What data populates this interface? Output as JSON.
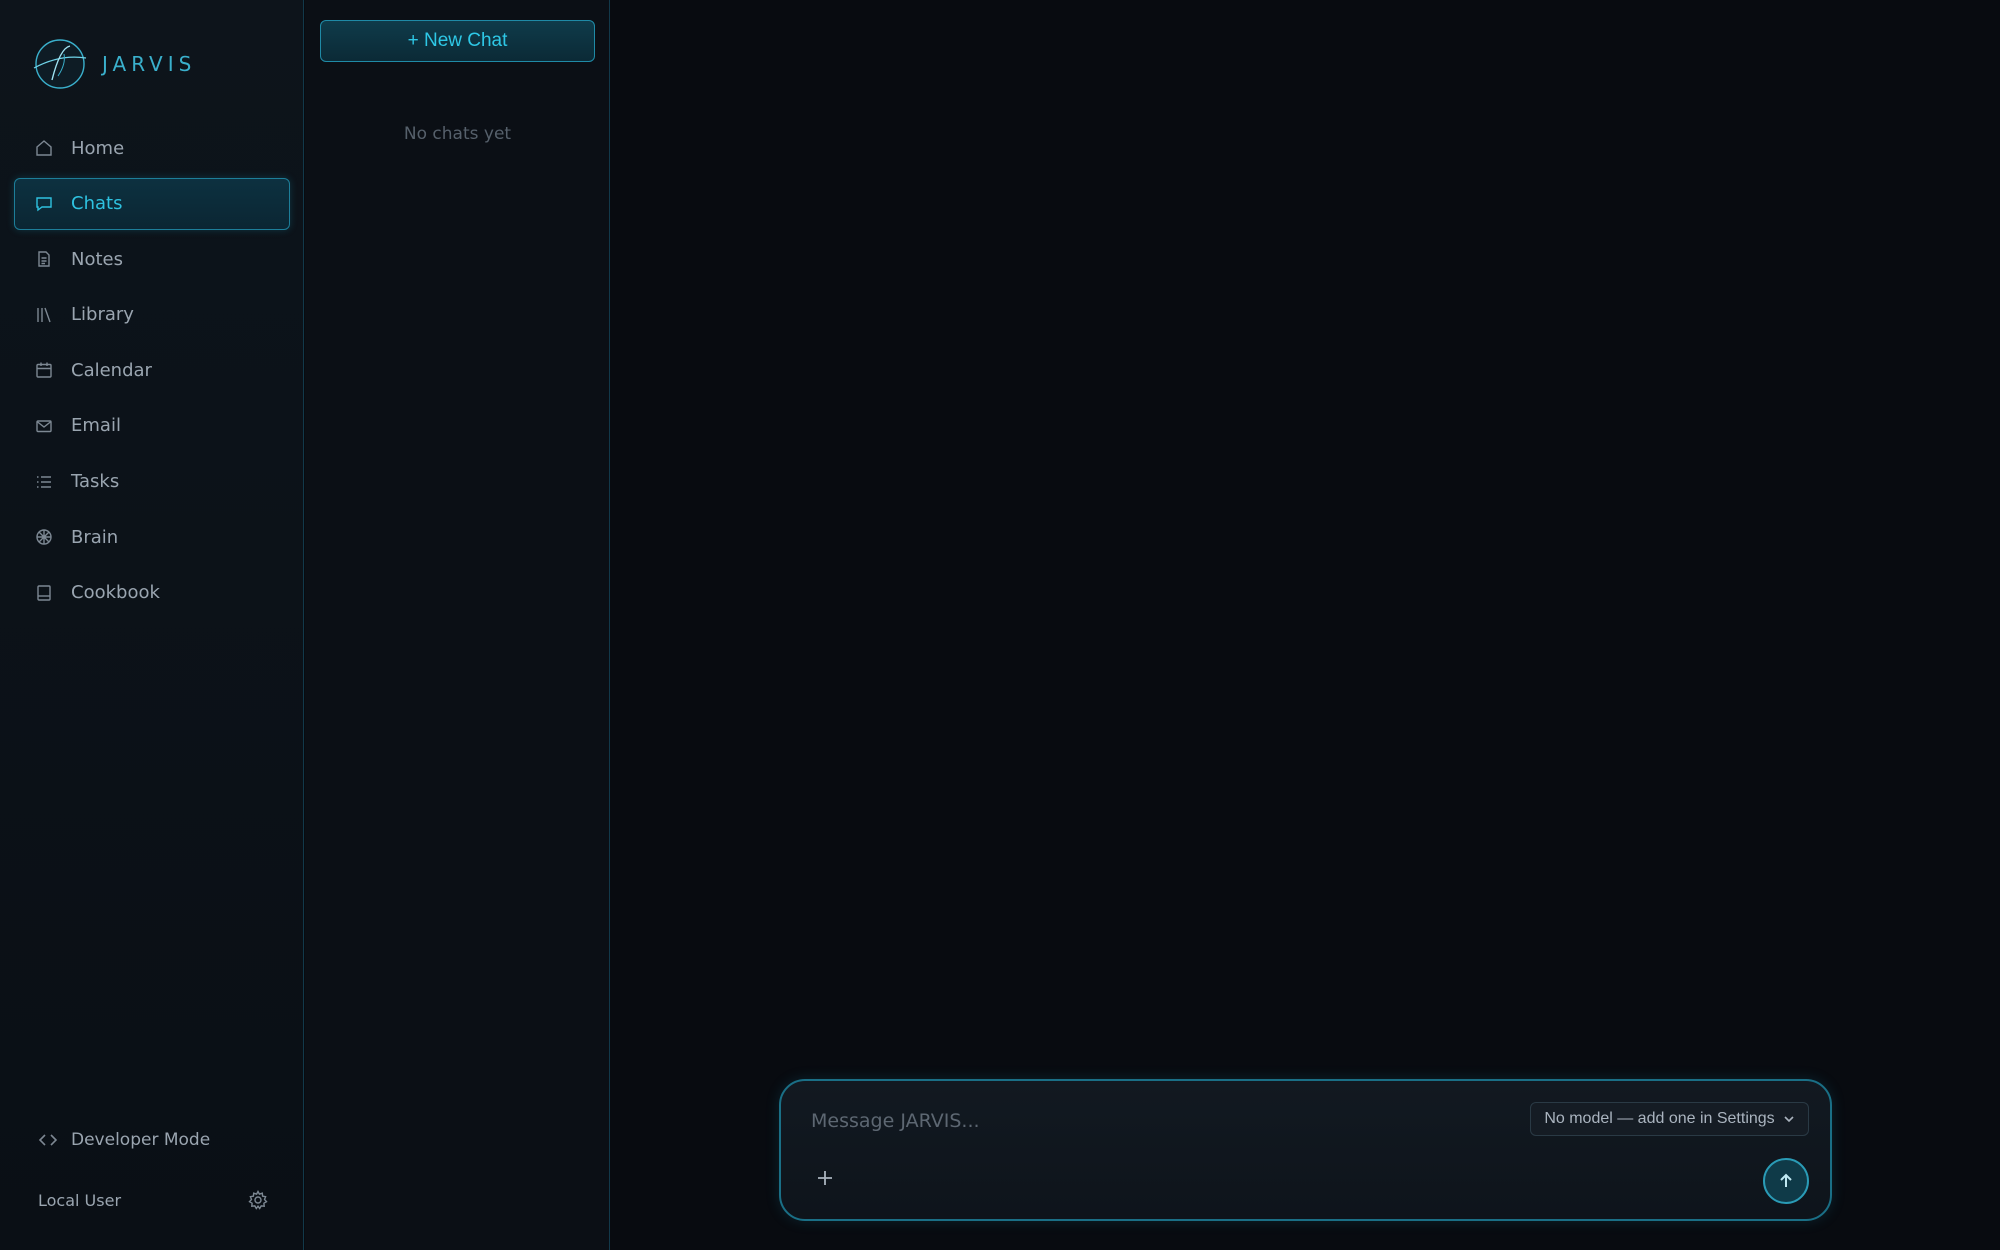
{
  "app": {
    "brand": "JARVIS"
  },
  "sidebar": {
    "items": [
      {
        "label": "Home",
        "icon": "home-icon"
      },
      {
        "label": "Chats",
        "icon": "chat-bubble-icon",
        "active": true
      },
      {
        "label": "Notes",
        "icon": "document-icon"
      },
      {
        "label": "Library",
        "icon": "library-icon"
      },
      {
        "label": "Calendar",
        "icon": "calendar-icon"
      },
      {
        "label": "Email",
        "icon": "envelope-icon"
      },
      {
        "label": "Tasks",
        "icon": "list-icon"
      },
      {
        "label": "Brain",
        "icon": "brain-icon"
      },
      {
        "label": "Cookbook",
        "icon": "book-icon"
      }
    ],
    "developer_mode_label": "Developer Mode",
    "user_label": "Local User"
  },
  "chatlist": {
    "new_chat_label": "+ New Chat",
    "empty_label": "No chats yet"
  },
  "composer": {
    "placeholder": "Message JARVIS...",
    "model_label": "No model — add one in Settings"
  },
  "colors": {
    "accent": "#2ec2e0",
    "background": "#080b10",
    "border": "#12394a"
  }
}
